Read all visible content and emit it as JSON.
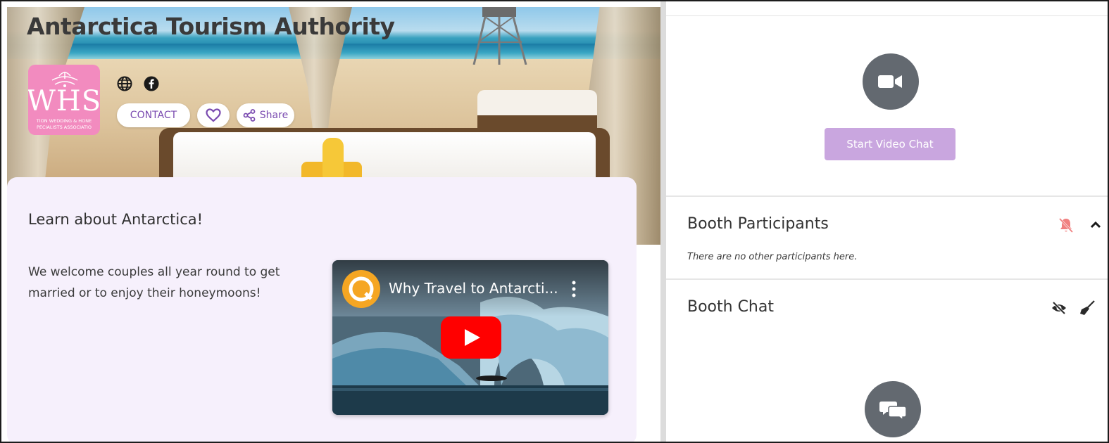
{
  "booth": {
    "title": "Antarctica Tourism Authority",
    "logo": {
      "text": "WHS",
      "subline1": "TION WEDDING & HONE",
      "subline2": "PECIALISTS ASSOCIATIO",
      "color": "#f28bbf"
    },
    "social_icons": [
      "globe-icon",
      "facebook-icon"
    ],
    "buttons": {
      "contact_label": "CONTACT",
      "favorite_icon": "heart-icon",
      "share_label": "Share",
      "share_icon": "share-icon"
    },
    "card": {
      "title": "Learn about Antarctica!",
      "description": "We welcome couples all year round to get married or to enjoy their honeymoons!"
    },
    "video": {
      "title": "Why Travel to Antarcti...",
      "player": "youtube",
      "icons": [
        "channel-logo",
        "more-vert-icon",
        "play-icon"
      ]
    }
  },
  "sidebar": {
    "video_chat": {
      "icon": "video-camera-icon",
      "button_label": "Start Video Chat",
      "button_color": "#c9a6df"
    },
    "participants": {
      "title": "Booth Participants",
      "empty_text": "There are no other participants here.",
      "icons": [
        "muted-bell-icon",
        "chevron-up-icon"
      ],
      "muted_icon_color": "#f08080"
    },
    "chat": {
      "title": "Booth Chat",
      "icons": [
        "eye-slash-icon",
        "broom-icon",
        "chat-bubbles-icon"
      ]
    }
  },
  "colors": {
    "accent_purple": "#7a4bb0",
    "card_background": "#f6f0fc",
    "icon_circle": "#636970"
  }
}
